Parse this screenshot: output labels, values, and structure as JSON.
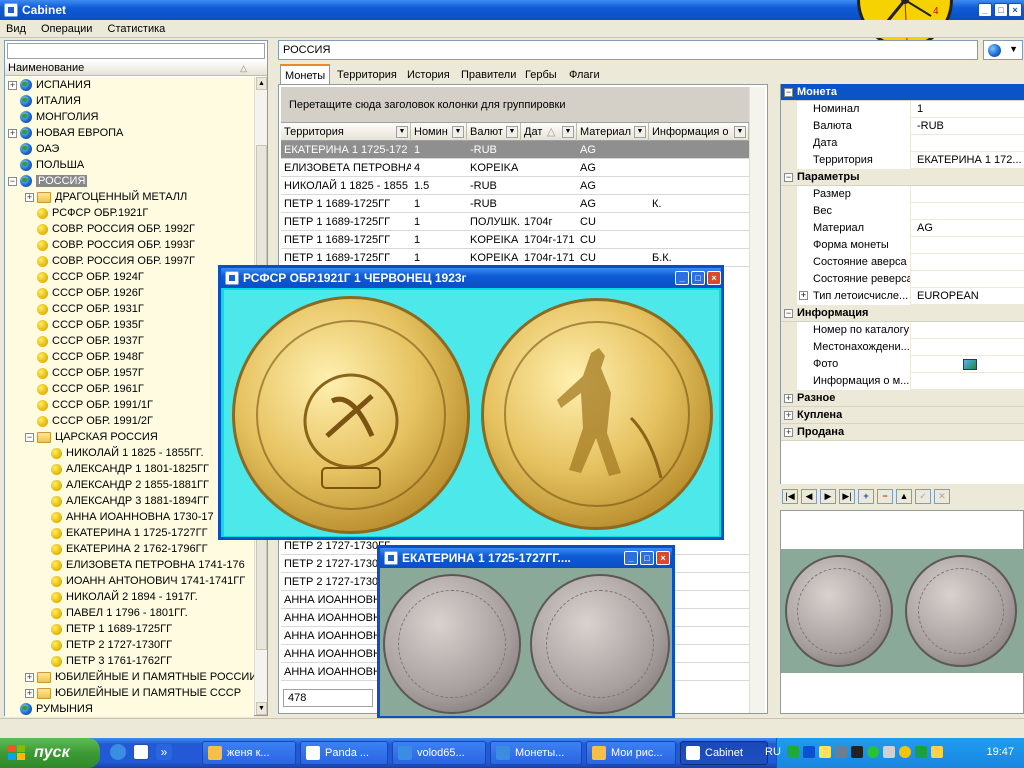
{
  "window": {
    "title": "Cabinet"
  },
  "menu": [
    "Вид",
    "Операции",
    "Статистика"
  ],
  "left": {
    "column_header": "Наименование",
    "tree": [
      {
        "label": "ИСПАНИЯ",
        "icon": "globe-icon",
        "level": 0,
        "expander": "+"
      },
      {
        "label": "ИТАЛИЯ",
        "icon": "globe-icon",
        "level": 0,
        "expander": ""
      },
      {
        "label": "МОНГОЛИЯ",
        "icon": "globe-icon",
        "level": 0,
        "expander": ""
      },
      {
        "label": "НОВАЯ ЕВРОПА",
        "icon": "globe-icon",
        "level": 0,
        "expander": "+"
      },
      {
        "label": "ОАЭ",
        "icon": "globe-icon",
        "level": 0,
        "expander": ""
      },
      {
        "label": "ПОЛЬША",
        "icon": "globe-icon",
        "level": 0,
        "expander": ""
      },
      {
        "label": "РОССИЯ",
        "icon": "globe-icon",
        "level": 0,
        "expander": "−",
        "selected": true
      },
      {
        "label": "ДРАГОЦЕННЫЙ МЕТАЛЛ",
        "icon": "folder-icon",
        "level": 1,
        "expander": "+"
      },
      {
        "label": "РСФСР ОБР.1921Г",
        "icon": "coin-icon",
        "level": 1,
        "expander": ""
      },
      {
        "label": "СОВР. РОССИЯ ОБР. 1992Г",
        "icon": "coin-icon",
        "level": 1,
        "expander": ""
      },
      {
        "label": "СОВР. РОССИЯ ОБР. 1993Г",
        "icon": "coin-icon",
        "level": 1,
        "expander": ""
      },
      {
        "label": "СОВР. РОССИЯ ОБР. 1997Г",
        "icon": "coin-icon",
        "level": 1,
        "expander": ""
      },
      {
        "label": "СССР ОБР. 1924Г",
        "icon": "coin-icon",
        "level": 1,
        "expander": ""
      },
      {
        "label": "СССР ОБР. 1926Г",
        "icon": "coin-icon",
        "level": 1,
        "expander": ""
      },
      {
        "label": "СССР ОБР. 1931Г",
        "icon": "coin-icon",
        "level": 1,
        "expander": ""
      },
      {
        "label": "СССР ОБР. 1935Г",
        "icon": "coin-icon",
        "level": 1,
        "expander": ""
      },
      {
        "label": "СССР ОБР. 1937Г",
        "icon": "coin-icon",
        "level": 1,
        "expander": ""
      },
      {
        "label": "СССР ОБР. 1948Г",
        "icon": "coin-icon",
        "level": 1,
        "expander": ""
      },
      {
        "label": "СССР ОБР. 1957Г",
        "icon": "coin-icon",
        "level": 1,
        "expander": ""
      },
      {
        "label": "СССР ОБР. 1961Г",
        "icon": "coin-icon",
        "level": 1,
        "expander": ""
      },
      {
        "label": "СССР ОБР. 1991/1Г",
        "icon": "coin-icon",
        "level": 1,
        "expander": ""
      },
      {
        "label": "СССР ОБР. 1991/2Г",
        "icon": "coin-icon",
        "level": 1,
        "expander": ""
      },
      {
        "label": "ЦАРСКАЯ РОССИЯ",
        "icon": "folder-icon",
        "level": 1,
        "expander": "−"
      },
      {
        "label": "НИКОЛАЙ 1 1825 - 1855ГГ.",
        "icon": "coin-icon",
        "level": 2,
        "expander": ""
      },
      {
        "label": "АЛЕКСАНДР 1  1801-1825ГГ",
        "icon": "coin-icon",
        "level": 2,
        "expander": ""
      },
      {
        "label": "АЛЕКСАНДР 2  1855-1881ГГ",
        "icon": "coin-icon",
        "level": 2,
        "expander": ""
      },
      {
        "label": "АЛЕКСАНДР 3  1881-1894ГГ",
        "icon": "coin-icon",
        "level": 2,
        "expander": ""
      },
      {
        "label": "АННА ИОАННОВНА  1730-17",
        "icon": "coin-icon",
        "level": 2,
        "expander": ""
      },
      {
        "label": "ЕКАТЕРИНА 1  1725-1727ГГ",
        "icon": "coin-icon",
        "level": 2,
        "expander": ""
      },
      {
        "label": "ЕКАТЕРИНА 2  1762-1796ГГ",
        "icon": "coin-icon",
        "level": 2,
        "expander": ""
      },
      {
        "label": "ЕЛИЗОВЕТА ПЕТРОВНА 1741-176",
        "icon": "coin-icon",
        "level": 2,
        "expander": ""
      },
      {
        "label": "ИОАНН АНТОНОВИЧ 1741-1741ГГ",
        "icon": "coin-icon",
        "level": 2,
        "expander": ""
      },
      {
        "label": "НИКОЛАЙ 2  1894 - 1917Г.",
        "icon": "coin-icon",
        "level": 2,
        "expander": ""
      },
      {
        "label": "ПАВЕЛ 1  1796 - 1801ГГ.",
        "icon": "coin-icon",
        "level": 2,
        "expander": ""
      },
      {
        "label": "ПЕТР 1  1689-1725ГГ",
        "icon": "coin-icon",
        "level": 2,
        "expander": ""
      },
      {
        "label": "ПЕТР 2  1727-1730ГГ",
        "icon": "coin-icon",
        "level": 2,
        "expander": ""
      },
      {
        "label": "ПЕТР 3  1761-1762ГГ",
        "icon": "coin-icon",
        "level": 2,
        "expander": ""
      },
      {
        "label": "ЮБИЛЕЙНЫЕ И ПАМЯТНЫЕ РОССИИ",
        "icon": "folder-icon",
        "level": 1,
        "expander": "+"
      },
      {
        "label": "ЮБИЛЕЙНЫЕ И ПАМЯТНЫЕ СССР",
        "icon": "folder-icon",
        "level": 1,
        "expander": "+"
      },
      {
        "label": "РУМЫНИЯ",
        "icon": "globe-icon",
        "level": 0,
        "expander": ""
      }
    ]
  },
  "search": {
    "value": "РОССИЯ"
  },
  "tabs": [
    {
      "label": "Монеты",
      "active": true
    },
    {
      "label": "Территория",
      "active": false
    },
    {
      "label": "История",
      "active": false
    },
    {
      "label": "Правители",
      "active": false
    },
    {
      "label": "Гербы",
      "active": false
    },
    {
      "label": "Флаги",
      "active": false
    }
  ],
  "grid": {
    "group_hint": "Перетащите сюда заголовок колонки для группировки",
    "columns": [
      "Территория",
      "Номин",
      "Валют",
      "Дат",
      "Материал",
      "Информация о"
    ],
    "rows": [
      {
        "cells": [
          "ЕКАТЕРИНА 1  1725-172",
          "1",
          "-RUB",
          "",
          "AG",
          ""
        ],
        "selected": true
      },
      {
        "cells": [
          "ЕЛИЗОВЕТА ПЕТРОВНА",
          "4",
          "KOPEIKA",
          "",
          "AG",
          ""
        ]
      },
      {
        "cells": [
          " НИКОЛАЙ 1 1825 - 1855",
          "1.5",
          "-RUB",
          "",
          "AG",
          ""
        ]
      },
      {
        "cells": [
          "ПЕТР 1  1689-1725ГГ",
          "1",
          "-RUB",
          "",
          "AG",
          "К."
        ]
      },
      {
        "cells": [
          "ПЕТР 1  1689-1725ГГ",
          "1",
          "ПОЛУШК.",
          "1704г",
          "CU",
          ""
        ]
      },
      {
        "cells": [
          "ПЕТР 1  1689-1725ГГ",
          "1",
          "KOPEIKA",
          "1704г-171",
          "CU",
          ""
        ]
      },
      {
        "cells": [
          "ПЕТР 1  1689-1725ГГ",
          "1",
          "KOPEIKA",
          "1704г-171",
          "CU",
          "Б.К."
        ]
      }
    ],
    "bottom_rows": [
      {
        "cells": [
          "ПЕТР 2  1727-1730ГГ",
          "",
          "",
          "",
          "",
          ""
        ]
      },
      {
        "cells": [
          "ПЕТР 2  1727-1730ГГ",
          "",
          "",
          "",
          "",
          ""
        ]
      },
      {
        "cells": [
          "ПЕТР 2  1727-1730ГГ",
          "",
          "",
          "",
          "",
          "ква"
        ]
      },
      {
        "cells": [
          "АННА ИОАННОВНА",
          "",
          "",
          "",
          "",
          ""
        ]
      },
      {
        "cells": [
          "АННА ИОАННОВНА",
          "",
          "",
          "",
          "",
          ""
        ]
      },
      {
        "cells": [
          "АННА ИОАННОВНА",
          "",
          "",
          "",
          "",
          ""
        ]
      },
      {
        "cells": [
          "АННА ИОАННОВНА",
          "",
          "",
          "",
          "",
          ""
        ]
      },
      {
        "cells": [
          "АННА ИОАННОВНА",
          "",
          "",
          "",
          "",
          ""
        ]
      }
    ],
    "footer_value": "478"
  },
  "properties": {
    "sections": [
      {
        "title": "Монета",
        "selected": true,
        "rows": [
          {
            "key": "Номинал",
            "value": "1"
          },
          {
            "key": "Валюта",
            "value": "-RUB"
          },
          {
            "key": "Дата",
            "value": ""
          },
          {
            "key": "Территория",
            "value": "ЕКАТЕРИНА 1  172..."
          }
        ]
      },
      {
        "title": "Параметры",
        "rows": [
          {
            "key": "Размер",
            "value": ""
          },
          {
            "key": "Вес",
            "value": ""
          },
          {
            "key": "Материал",
            "value": "AG"
          },
          {
            "key": "Форма монеты",
            "value": ""
          },
          {
            "key": "Состояние аверса",
            "value": ""
          },
          {
            "key": "Состояние реверса",
            "value": ""
          },
          {
            "key": "Тип летоисчисле...",
            "value": "EUROPEAN",
            "expander": "+"
          }
        ]
      },
      {
        "title": "Информация",
        "rows": [
          {
            "key": "Номер по каталогу",
            "value": ""
          },
          {
            "key": "Местонахождени...",
            "value": ""
          },
          {
            "key": "Фото",
            "value": "",
            "photo": true
          },
          {
            "key": "Информация о м...",
            "value": ""
          }
        ]
      },
      {
        "title": "Разное",
        "rows": []
      },
      {
        "title": "Куплена",
        "rows": []
      },
      {
        "title": "Продана",
        "rows": []
      }
    ]
  },
  "nav_buttons": [
    "|◀",
    "◀",
    "▶",
    "▶|",
    "+",
    "−",
    "▲",
    "✓",
    "✕"
  ],
  "popup1": {
    "title": "РСФСР ОБР.1921Г 1 ЧЕРВОНЕЦ 1923г"
  },
  "popup2": {
    "title": "ЕКАТЕРИНА 1  1725-1727ГГ...."
  },
  "taskbar": {
    "start": "пуск",
    "tasks": [
      {
        "label": "женя к...",
        "icon_color": "#f5c04a"
      },
      {
        "label": "Panda ...",
        "icon_color": "#ffffff"
      },
      {
        "label": "volod65...",
        "icon_color": "#3a8de0"
      },
      {
        "label": "Монеты...",
        "icon_color": "#3a8de0"
      },
      {
        "label": "Мои рис...",
        "icon_color": "#f5c04a"
      },
      {
        "label": "Cabinet",
        "icon_color": "#ffffff",
        "active": true
      }
    ],
    "lang": "RU",
    "time": "19:47"
  }
}
